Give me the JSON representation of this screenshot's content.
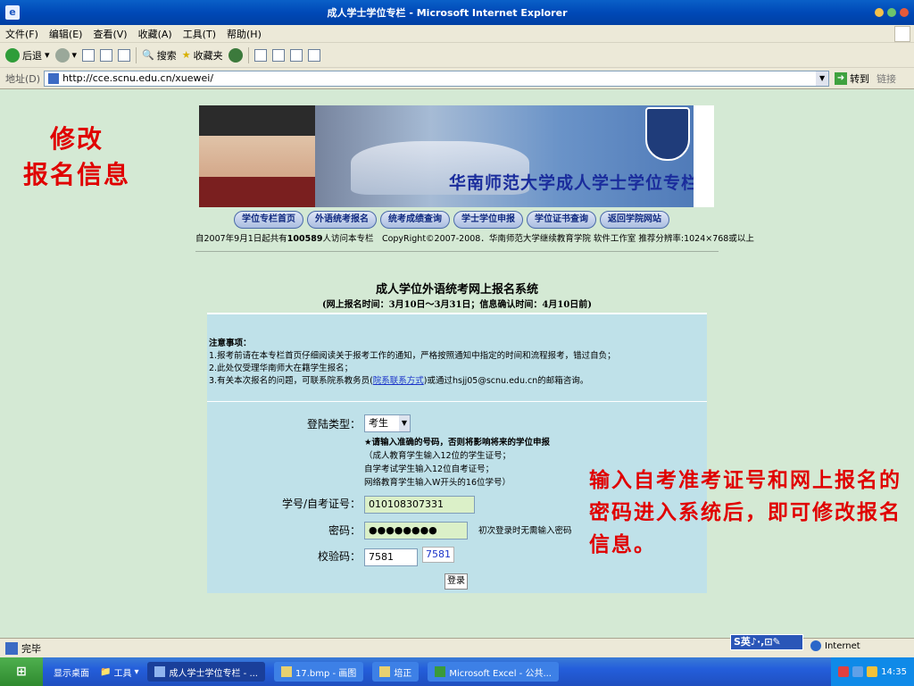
{
  "window": {
    "title": "成人学士学位专栏 - Microsoft Internet Explorer"
  },
  "menu": [
    "文件(F)",
    "编辑(E)",
    "查看(V)",
    "收藏(A)",
    "工具(T)",
    "帮助(H)"
  ],
  "toolbar": {
    "back": "后退",
    "search": "搜索",
    "favorites": "收藏夹"
  },
  "address": {
    "label": "地址(D)",
    "url": "http://cce.scnu.edu.cn/xuewei/",
    "go": "转到",
    "links": "链接"
  },
  "annotations": {
    "side_line1": "修改",
    "side_line2": "报名信息",
    "callout": "输入自考准考证号和网上报名的密码进入系统后，即可修改报名信息。"
  },
  "banner": {
    "title": "华南师范大学成人学士学位专栏"
  },
  "nav": [
    "学位专栏首页",
    "外语统考报名",
    "统考成绩查询",
    "学士学位申报",
    "学位证书查询",
    "返回学院网站"
  ],
  "visit": {
    "prefix": "自2007年9月1日起共有",
    "count": "100589",
    "suffix": "人访问本专栏　CopyRight©2007-2008．华南师范大学继续教育学院 软件工作室  推荐分辨率:1024×768或以上"
  },
  "system": {
    "title": "成人学位外语统考网上报名系统",
    "subtitle": "(网上报名时间：3月10日～3月31日；信息确认时间：4月10日前)"
  },
  "notice": {
    "heading": "注意事项：",
    "item1": "1.报考前请在本专栏首页仔细阅读关于报考工作的通知，严格按照通知中指定的时间和流程报考，错过自负；",
    "item2": "2.此处仅受理华南师大在籍学生报名；",
    "item3_pre": "3.有关本次报名的问题，可联系院系教务员(",
    "item3_link": "院系联系方式",
    "item3_post": ")或通过hsjj05@scnu.edu.cn的邮箱咨询。"
  },
  "form": {
    "login_type_label": "登陆类型：",
    "login_type_value": "考生",
    "tip_heading": "★请输入准确的号码，否则将影响将来的学位申报",
    "tip1": "（成人教育学生输入12位的学生证号；",
    "tip2": "自学考试学生输入12位自考证号；",
    "tip3": "网络教育学生输入W开头的16位学号）",
    "id_label": "学号/自考证号：",
    "id_value": "010108307331",
    "password_label": "密码：",
    "password_value": "●●●●●●●●",
    "password_note": "初次登录时无需输入密码",
    "captcha_label": "校验码：",
    "captcha_value": "7581",
    "captcha_image": "7581",
    "login_button": "登录"
  },
  "status": {
    "text": "完毕",
    "zone": "Internet",
    "ime": "S英♪·,⊡✎"
  },
  "taskbar": {
    "desktop": "显示桌面",
    "tools": "工具",
    "tasks": [
      "成人学士学位专栏 - ...",
      "17.bmp - 画图",
      "培正",
      "Microsoft Excel - 公共..."
    ],
    "clock": "14:35"
  }
}
